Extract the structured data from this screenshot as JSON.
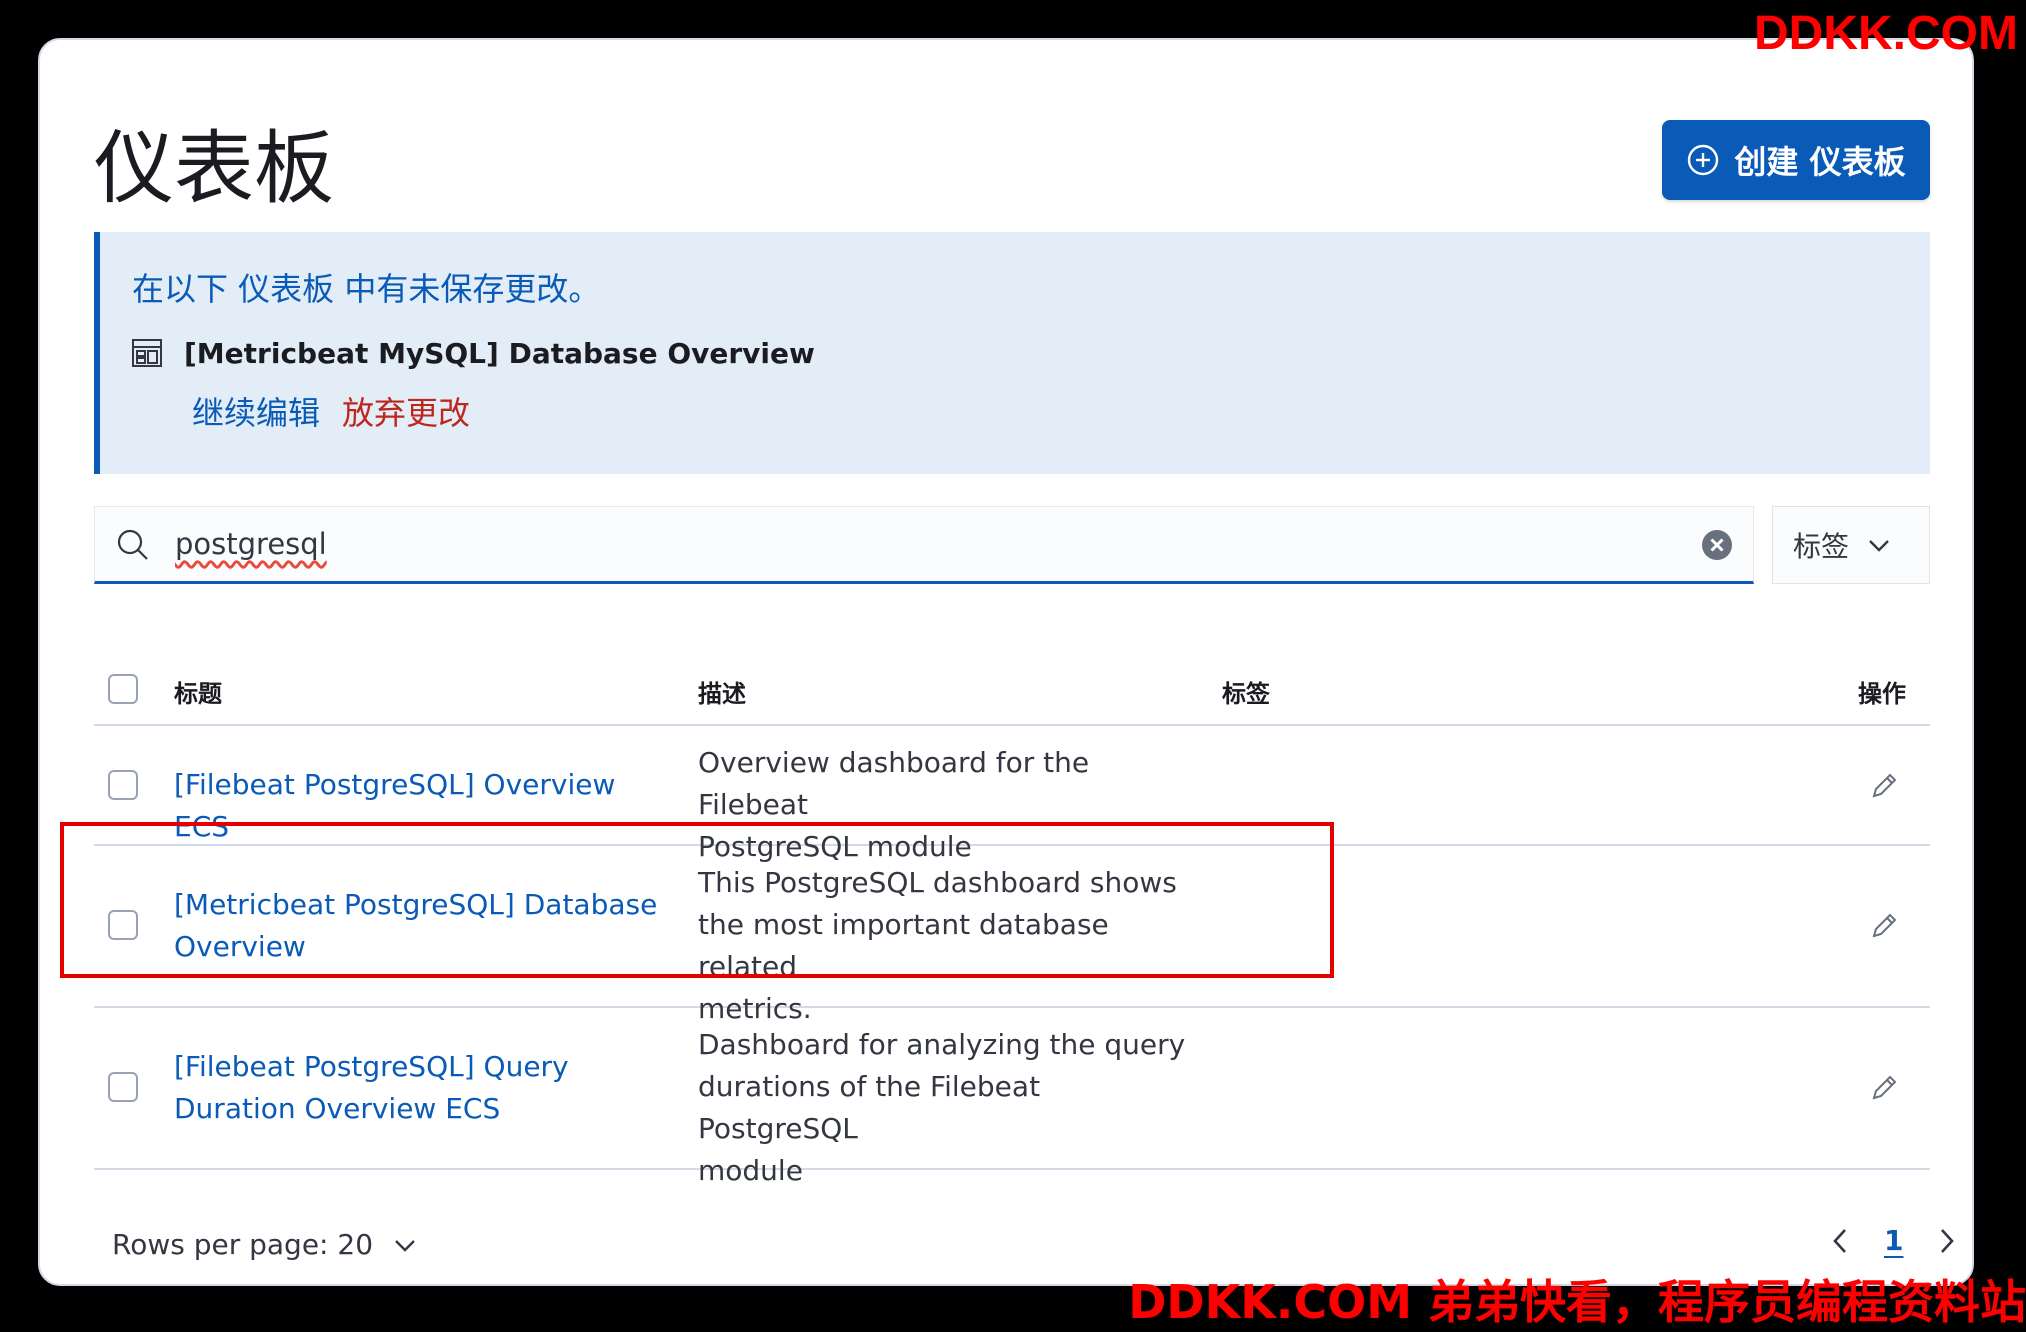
{
  "watermark": {
    "top": "DDKK.COM",
    "bottom": "DDKK.COM 弟弟快看，程序员编程资料站"
  },
  "page": {
    "title": "仪表板",
    "create_button": "创建 仪表板"
  },
  "callout": {
    "title": "在以下 仪表板 中有未保存更改。",
    "item_name": "[Metricbeat MySQL] Database Overview",
    "continue_label": "继续编辑",
    "discard_label": "放弃更改"
  },
  "search": {
    "value": "postgresql",
    "tags_label": "标签"
  },
  "table": {
    "columns": {
      "title": "标题",
      "description": "描述",
      "tags": "标签",
      "actions": "操作"
    },
    "rows": [
      {
        "title_line1": "[Filebeat PostgreSQL] Overview ECS",
        "title_line2": "",
        "desc_line1": "Overview dashboard for the Filebeat",
        "desc_line2": "PostgreSQL module",
        "desc_line3": ""
      },
      {
        "title_line1": "[Metricbeat PostgreSQL] Database",
        "title_line2": "Overview",
        "desc_line1": "This PostgreSQL dashboard shows",
        "desc_line2": "the most important database related",
        "desc_line3": "metrics."
      },
      {
        "title_line1": "[Filebeat PostgreSQL] Query",
        "title_line2": "Duration Overview ECS",
        "desc_line1": "Dashboard for analyzing the query",
        "desc_line2": "durations of the Filebeat PostgreSQL",
        "desc_line3": "module"
      }
    ]
  },
  "pagination": {
    "rows_per_page": "Rows per page: 20",
    "current_page": "1"
  },
  "colors": {
    "primary": "#0a5ab8",
    "danger": "#bd271e",
    "callout_bg": "#e3edf7",
    "highlight": "#e50000"
  }
}
